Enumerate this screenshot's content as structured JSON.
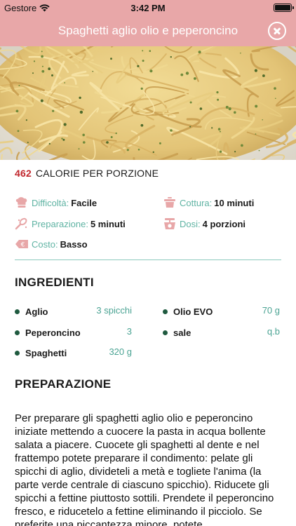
{
  "status_bar": {
    "carrier": "Gestore",
    "time": "3:42 PM"
  },
  "header": {
    "title": "Spaghetti aglio olio e peperoncino"
  },
  "colors": {
    "accent": "#e8a7a8",
    "teal": "#5fb3a3",
    "calories": "#c1272d",
    "bullet": "#1f5a3f"
  },
  "nutrition": {
    "calories": "462",
    "calories_label": "CALORIE PER PORZIONE"
  },
  "info": {
    "difficolta": {
      "label": "Difficoltà:",
      "value": "Facile",
      "icon": "chef-hat-icon"
    },
    "cottura": {
      "label": "Cottura:",
      "value": "10 minuti",
      "icon": "pot-icon"
    },
    "preparazione": {
      "label": "Preparazione:",
      "value": "5 minuti",
      "icon": "whisk-icon"
    },
    "dosi": {
      "label": "Dosi:",
      "value": "4 porzioni",
      "icon": "scale-icon"
    },
    "costo": {
      "label": "Costo:",
      "value": "Basso",
      "icon": "euro-tag-icon"
    }
  },
  "ingredients": {
    "title": "INGREDIENTI",
    "items": [
      {
        "name": "Aglio",
        "qty": "3 spicchi"
      },
      {
        "name": "Olio EVO",
        "qty": "70 g"
      },
      {
        "name": "Peperoncino",
        "qty": "3"
      },
      {
        "name": "sale",
        "qty": "q.b"
      },
      {
        "name": "Spaghetti",
        "qty": "320 g"
      }
    ]
  },
  "preparation": {
    "title": "PREPARAZIONE",
    "text": "Per preparare gli spaghetti aglio olio e peperoncino iniziate mettendo a cuocere la pasta in acqua bollente salata a piacere. Cuocete gli spaghetti al dente e nel frattempo potete preparare il condimento: pelate gli spicchi di aglio, divideteli a metà e togliete l'anima (la parte verde centrale di ciascuno spicchio). Riducete gli spicchi a fettine piuttosto sottili. Prendete il peperoncino fresco, e riducetelo a fettine eliminando il picciolo. Se preferite una piccantezza minore, potete"
  }
}
